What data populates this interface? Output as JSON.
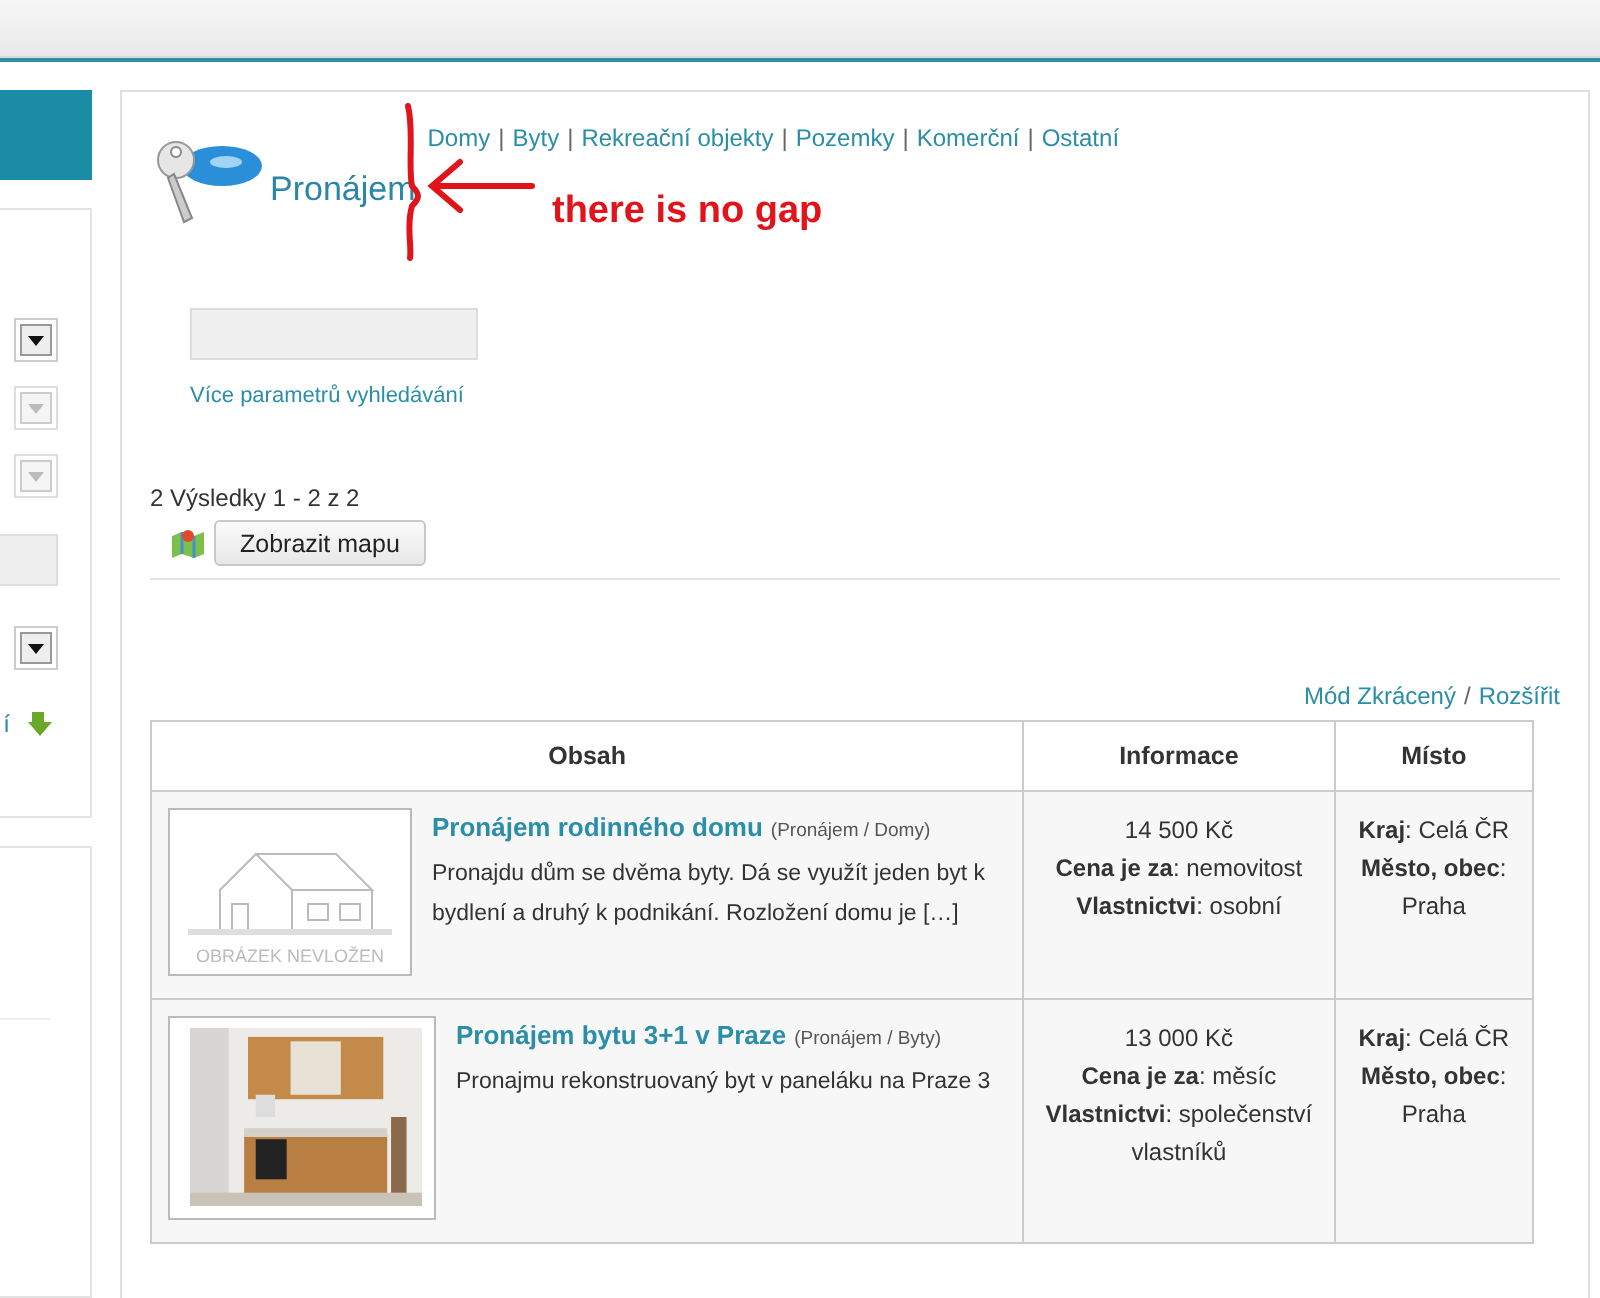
{
  "sidebar": {
    "controls": [
      {
        "kind": "select",
        "disabled": false
      },
      {
        "kind": "select",
        "disabled": true
      },
      {
        "kind": "select",
        "disabled": true
      },
      {
        "kind": "input"
      },
      {
        "kind": "select",
        "disabled": false
      }
    ],
    "link_fragment": "í"
  },
  "header": {
    "title": "Pronájem",
    "separator": "|",
    "category_links": [
      "Domy",
      "Byty",
      "Rekreační objekty",
      "Pozemky",
      "Komerční",
      "Ostatní"
    ]
  },
  "annotation": {
    "text": "there is no gap"
  },
  "search": {
    "more_link": "Více parametrů vyhledávání"
  },
  "results": {
    "summary": "2 Výsledky 1 - 2 z 2",
    "map_button": "Zobrazit mapu"
  },
  "view_mode_links": [
    "Mód Zkrácený",
    "Rozšířit"
  ],
  "view_mode_separator": "/",
  "table": {
    "columns": [
      "Obsah",
      "Informace",
      "Místo"
    ],
    "rows": [
      {
        "image": {
          "kind": "placeholder",
          "caption": "OBRÁZEK NEVLOŽEN"
        },
        "title": "Pronájem rodinného domu",
        "category": "(Pronájem / Domy)",
        "description": "Pronajdu dům se dvěma byty. Dá se využít jeden byt k bydlení a druhý k podnikání. Rozložení domu je […]",
        "info": [
          "14 500 Kč",
          "**Cena je za**: nemovitost",
          "**Vlastnictvi**: osobní"
        ],
        "location": [
          "**Kraj**: Celá ČR",
          "**Město, obec**:",
          "Praha"
        ]
      },
      {
        "title": "Pronájem bytu 3+1 v Praze",
        "category": "(Pronájem / Byty)",
        "description": "Pronajmu rekonstruovaný byt v paneláku na Praze 3",
        "info": [
          "13 000 Kč",
          "**Cena je za**: měsíc",
          "**Vlastnictvi**: společenství vlastníků"
        ],
        "location": [
          "**Kraj**: Celá ČR",
          "**Město, obec**:",
          "Praha"
        ]
      }
    ]
  }
}
